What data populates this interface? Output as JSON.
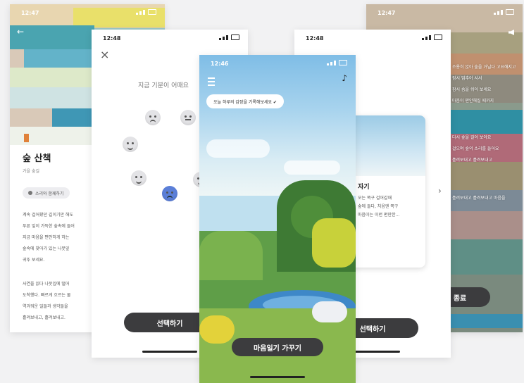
{
  "screens": {
    "walk_detail": {
      "time": "12:47",
      "title": "숲 산책",
      "subtitle": "가을 숲길",
      "chip_label": "소리와 함께하기",
      "body_lines": [
        "계속 걸어왔던 길이기만 해도",
        "푸른 잎이 가득한 숲속에 들어",
        "지금 마음을 편안하게 하는",
        "숲속에 찾아가 있는 나뭇잎",
        "귀뚜 보세요."
      ],
      "body2_lines": [
        "사연을 읽다 나뭇잎에 떨어",
        "도착했다. 빠르게 흐르는 물",
        "역겨워운 일들과 생각들을",
        "흘려보내고, 흘려보내고."
      ]
    },
    "mood": {
      "time": "12:48",
      "prompt": "지금 기분이 어때요",
      "select_label": "선택하기"
    },
    "main": {
      "time": "12:46",
      "banner": "오늘 하루의 감정을 기록해보세요 ✔",
      "cta_label": "마음일기 가꾸기"
    },
    "card": {
      "time": "12:48",
      "card_title": "자기",
      "card_lines": [
        "오는 쪽구 걸어갈때",
        "숲에 들다, 처음엔 쪽구",
        "마음이는 이런 편안한..."
      ],
      "select_label": "선택하기"
    },
    "story": {
      "time": "12:47",
      "lines": [
        "조용히 앉아 숲을 거닐다 고요해지고",
        "잠시 멈추어 서서",
        "잠시 숨을 쉬어 보세요",
        "마음이 편안해질 때까지",
        "",
        "다시 숲을 걸어 보아요",
        "걸으며 숲의 소리를 들어요",
        "흘려보내고 흘려보내고",
        "",
        "흘려보내고 흘려보내고 마음을"
      ],
      "button_label": "종료"
    }
  },
  "colors": {
    "dark_button": "#3c3c3e",
    "selected_face": "#5b7fd8",
    "marker": "#e0823a"
  }
}
